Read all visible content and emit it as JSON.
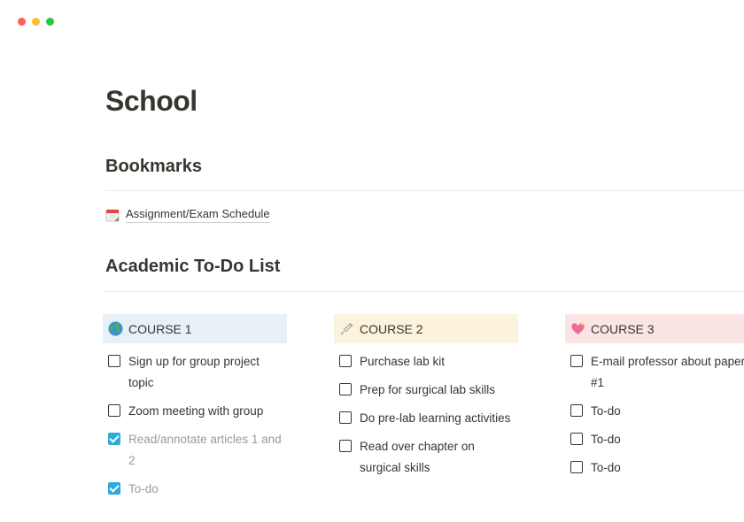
{
  "window": {
    "controls": [
      {
        "name": "close",
        "color": "#ff5f57"
      },
      {
        "name": "minimize",
        "color": "#febc2e"
      },
      {
        "name": "maximize",
        "color": "#28c840"
      }
    ]
  },
  "page": {
    "title": "School"
  },
  "bookmarks": {
    "heading": "Bookmarks",
    "items": [
      {
        "label": "Assignment/Exam Schedule",
        "icon": "calendar-icon"
      }
    ]
  },
  "todo": {
    "heading": "Academic To-Do List",
    "columns": [
      {
        "title": "COURSE 1",
        "icon": "globe-icon",
        "color": "#e7f0f7",
        "items": [
          {
            "text": "Sign up for group project topic",
            "checked": false
          },
          {
            "text": "Zoom meeting with group",
            "checked": false
          },
          {
            "text": "Read/annotate articles 1 and 2",
            "checked": true
          },
          {
            "text": "To-do",
            "checked": true
          }
        ]
      },
      {
        "title": "COURSE 2",
        "icon": "syringe-icon",
        "color": "#fbf3db",
        "items": [
          {
            "text": "Purchase lab kit",
            "checked": false
          },
          {
            "text": "Prep for surgical lab skills",
            "checked": false
          },
          {
            "text": "Do pre-lab learning activities",
            "checked": false
          },
          {
            "text": "Read over chapter on surgical skills",
            "checked": false
          }
        ]
      },
      {
        "title": "COURSE 3",
        "icon": "heart-icon",
        "color": "#fbe4e4",
        "items": [
          {
            "text": "E-mail professor about paper #1",
            "checked": false
          },
          {
            "text": "To-do",
            "checked": false
          },
          {
            "text": "To-do",
            "checked": false
          },
          {
            "text": "To-do",
            "checked": false
          }
        ]
      }
    ]
  }
}
